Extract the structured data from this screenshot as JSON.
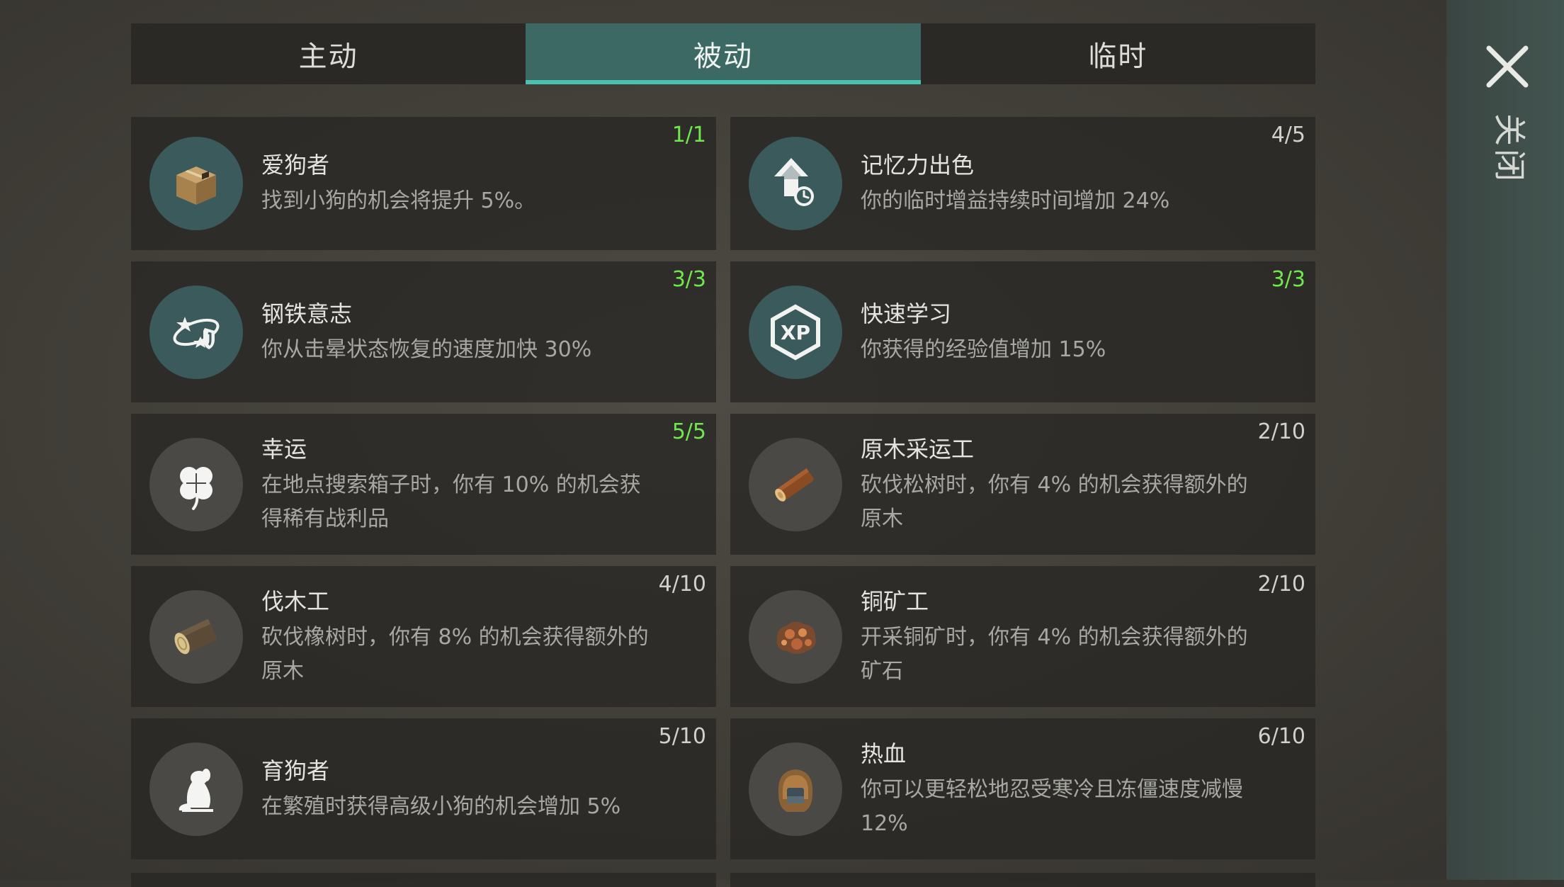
{
  "tabs": [
    {
      "label": "主动"
    },
    {
      "label": "被动",
      "active": true
    },
    {
      "label": "临时"
    }
  ],
  "close": {
    "label": "关闭",
    "icon": "close-icon"
  },
  "perks": [
    {
      "title": "爱狗者",
      "desc": "找到小狗的机会将提升 5%。",
      "level": "1/1",
      "maxed": true,
      "icon": "box-icon"
    },
    {
      "title": "记忆力出色",
      "desc": "你的临时增益持续时间增加 24%",
      "level": "4/5",
      "maxed": false,
      "icon": "boost-clock-icon"
    },
    {
      "title": "钢铁意志",
      "desc": "你从击晕状态恢复的速度加快 30%",
      "level": "3/3",
      "maxed": true,
      "icon": "stun-shield-icon"
    },
    {
      "title": "快速学习",
      "desc": "你获得的经验值增加 15%",
      "level": "3/3",
      "maxed": true,
      "icon": "xp-hexagon-icon"
    },
    {
      "title": "幸运",
      "desc": "在地点搜索箱子时，你有 10% 的机会获得稀有战利品",
      "level": "5/5",
      "maxed": true,
      "icon": "clover-icon"
    },
    {
      "title": "原木采运工",
      "desc": "砍伐松树时，你有 4% 的机会获得额外的原木",
      "level": "2/10",
      "maxed": false,
      "icon": "pine-log-icon"
    },
    {
      "title": "伐木工",
      "desc": "砍伐橡树时，你有 8% 的机会获得额外的原木",
      "level": "4/10",
      "maxed": false,
      "icon": "oak-log-icon"
    },
    {
      "title": "铜矿工",
      "desc": "开采铜矿时，你有 4% 的机会获得额外的矿石",
      "level": "2/10",
      "maxed": false,
      "icon": "copper-ore-icon"
    },
    {
      "title": "育狗者",
      "desc": "在繁殖时获得高级小狗的机会增加 5%",
      "level": "5/10",
      "maxed": false,
      "icon": "dog-icon"
    },
    {
      "title": "热血",
      "desc": "你可以更轻松地忍受寒冷且冻僵速度减慢 12%",
      "level": "6/10",
      "maxed": false,
      "icon": "hood-icon"
    }
  ]
}
